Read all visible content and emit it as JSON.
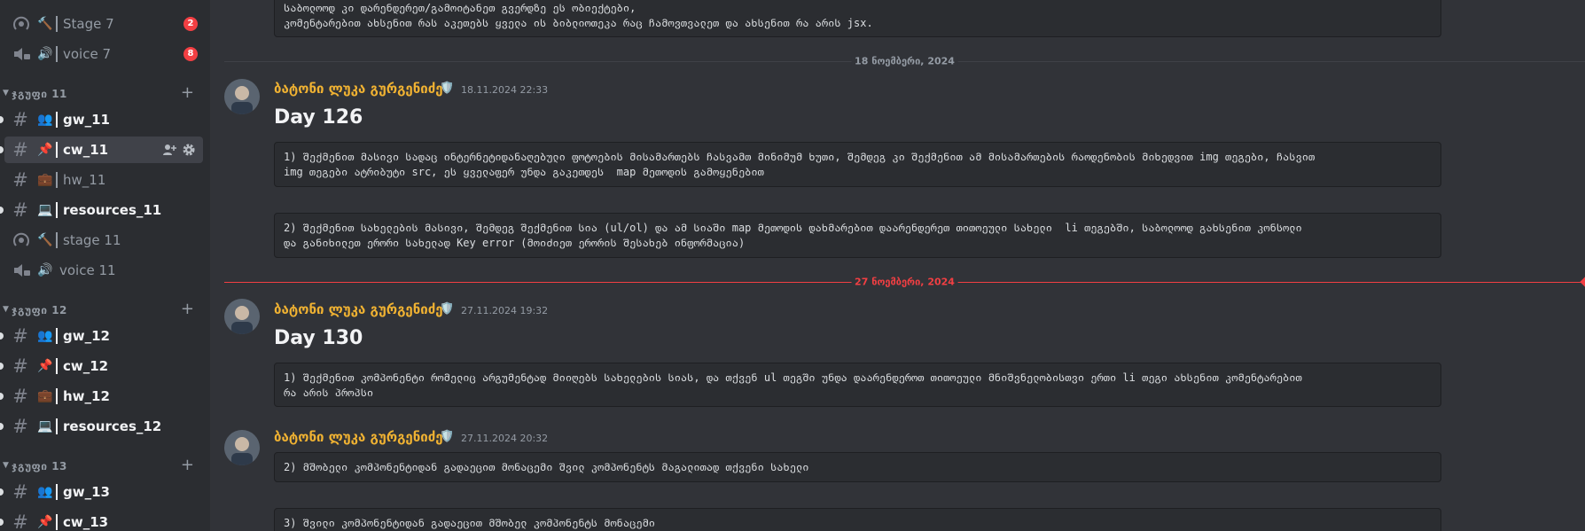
{
  "sidebar": {
    "channels_top": [
      {
        "name": "Stage 7",
        "badge": "2"
      },
      {
        "name": "voice 7",
        "badge": "8"
      }
    ],
    "cat11": {
      "name": "ჯგუფი 11",
      "channels": [
        {
          "emoji": "👥",
          "name": "gw_11"
        },
        {
          "emoji": "📌",
          "name": "cw_11"
        },
        {
          "emoji": "💼",
          "name": "hw_11"
        },
        {
          "emoji": "💻",
          "name": "resources_11"
        },
        {
          "name": "stage 11"
        },
        {
          "name": "voice 11"
        }
      ]
    },
    "cat12": {
      "name": "ჯგუფი 12",
      "channels": [
        {
          "emoji": "👥",
          "name": "gw_12"
        },
        {
          "emoji": "📌",
          "name": "cw_12"
        },
        {
          "emoji": "💼",
          "name": "hw_12"
        },
        {
          "emoji": "💻",
          "name": "resources_12"
        }
      ]
    },
    "cat13": {
      "name": "ჯგუფი 13",
      "channels": [
        {
          "emoji": "👥",
          "name": "gw_13"
        },
        {
          "emoji": "📌",
          "name": "cw_13"
        }
      ]
    }
  },
  "main": {
    "top_block": "საბოლოოდ კი დარენდერეთ/გამოიტანეთ გვერდზე ეს ობიექტები,\nკომენტარებით ახსენით რას აკეთებს ყველა ის ბიბლიოთეკა რაც ჩამოვთვალეთ და ახსენით რა არის jsx.",
    "divider1": "18 ნოემბერი, 2024",
    "msg1": {
      "author": "ბატონი ლუკა გურგენიძე",
      "time": "18.11.2024 22:33",
      "heading": "Day 126",
      "block1": "1) შექმენით მასივი სადაც ინტერნეტიდანაღებული ფოტოების მისამართებს ჩასვამთ მინიმუმ ხუთი, შემდეგ კი შექმენით ამ მისამართების რაოდენობის მიხედვით img თეგები, ჩასვით\nimg თეგები ატრიბუტი src, ეს ყველაფერ უნდა გაკეთდეს  map მეთოდის გამოყენებით",
      "block2": "2) შექმენით სახელების მასივი, შემდეგ შექმენით სია (ul/ol) და ამ სიაში map მეთოდის დახმარებით დაარენდერეთ თითოეული სახელი  li თეგებში, საბოლოოდ გახსენით კონსოლი\nდა განიხილეთ ერორი სახელად Key error (მოიძიეთ ერორის შესახებ ინფორმაცია)"
    },
    "divider2": "27 ნოემბერი, 2024",
    "msg2": {
      "author": "ბატონი ლუკა გურგენიძე",
      "time": "27.11.2024 19:32",
      "heading": "Day 130",
      "block1": "1) შექმენით კომპონენტი რომელიც არგუმენტად მიიღებს სახელების სიას, და თქვენ ul თეგში უნდა დაარენდეროთ თითოეული მნიშვნელობისთვი ერთი li თეგი ახსენით კომენტარებით\nრა არის პროპსი"
    },
    "msg3": {
      "author": "ბატონი ლუკა გურგენიძე",
      "time": "27.11.2024 20:32",
      "block1": "2) მშობელი კომპონენტიდან გადაეცით მონაცემი შვილ კომპონენტს მაგალითად თქვენი სახელი",
      "block2": "3) შვილი კომპონენტიდან გადაეცით მშობელ კომპონენტს მონაცემი"
    }
  }
}
